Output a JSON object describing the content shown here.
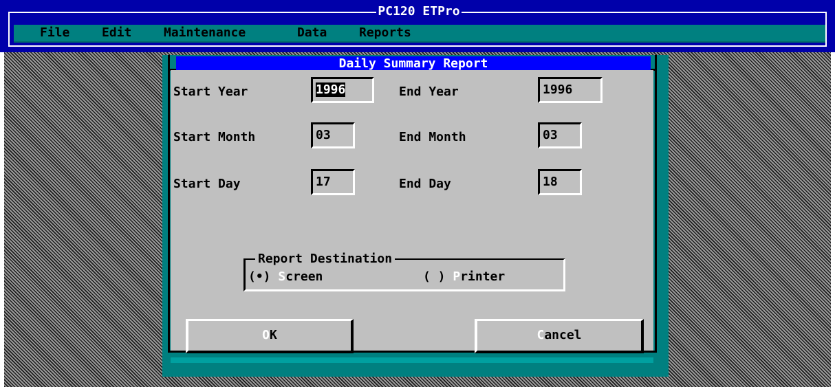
{
  "app": {
    "title": "PC120 ETPro"
  },
  "menu": {
    "items": [
      {
        "label": "File"
      },
      {
        "label": "Edit"
      },
      {
        "label": "Maintenance"
      },
      {
        "label": "Data"
      },
      {
        "label": "Reports"
      }
    ]
  },
  "dialog": {
    "title": "Daily Summary Report",
    "fields": {
      "start_year": {
        "label": "Start Year",
        "value_selected": "1996",
        "value_rest": ""
      },
      "end_year": {
        "label": "End Year",
        "value": "1996"
      },
      "start_month": {
        "label": "Start Month",
        "value": "03"
      },
      "end_month": {
        "label": "End Month",
        "value": "03"
      },
      "start_day": {
        "label": "Start Day",
        "value": "17"
      },
      "end_day": {
        "label": "End Day",
        "value": "18"
      }
    },
    "destination": {
      "legend": "Report Destination",
      "options": [
        {
          "marker": "(•)",
          "hotkey": "S",
          "rest": "creen",
          "selected": true
        },
        {
          "marker": "( )",
          "hotkey": "P",
          "rest": "rinter",
          "selected": false
        }
      ]
    },
    "buttons": {
      "ok": {
        "hotkey": "O",
        "rest": "K"
      },
      "cancel": {
        "hotkey": "C",
        "rest": "ancel"
      }
    }
  },
  "colors": {
    "app_blue": "#0000aa",
    "title_blue": "#0000ff",
    "teal": "#008080",
    "dialog_gray": "#c0c0c0"
  }
}
